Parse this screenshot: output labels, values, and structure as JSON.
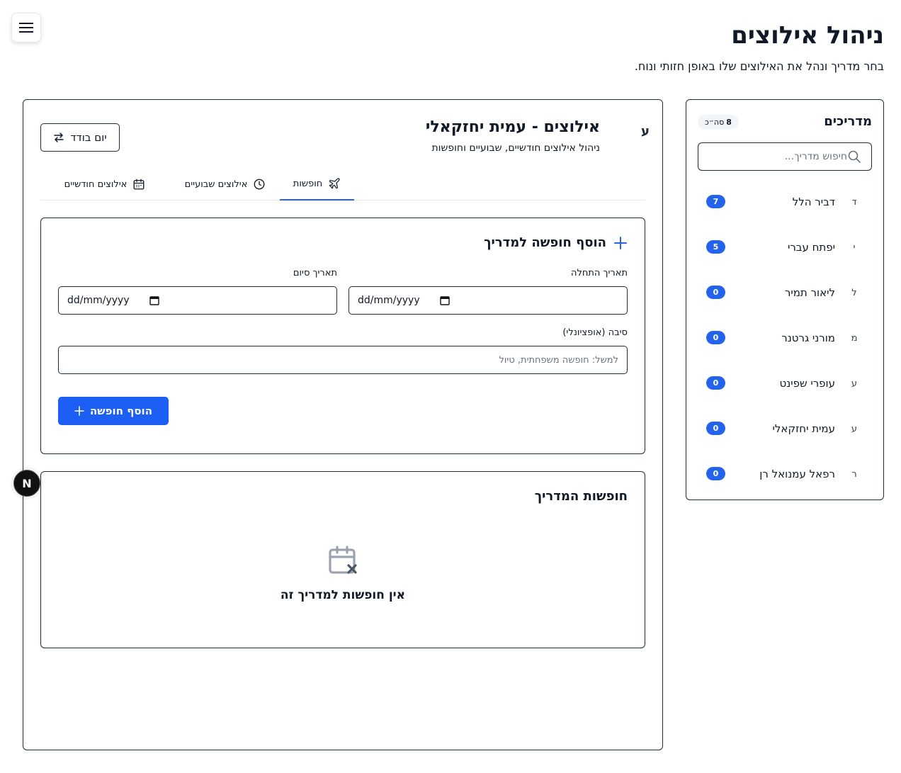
{
  "header": {
    "title": "ניהול אילוצים",
    "subtitle": "בחר מדריך ונהל את האילוצים שלו באופן חזותי ונוח."
  },
  "sidebar": {
    "title": "מדריכים",
    "count_number": "8",
    "count_suffix": "סה״כ",
    "search_placeholder": "חיפוש מדריך...",
    "guides": [
      {
        "initial": "ד",
        "name": "דביר הלל",
        "count": "7"
      },
      {
        "initial": "י",
        "name": "יפתח עברי",
        "count": "5"
      },
      {
        "initial": "ל",
        "name": "ליאור תמיר",
        "count": "0"
      },
      {
        "initial": "מ",
        "name": "מורני גרטנר",
        "count": "0"
      },
      {
        "initial": "ע",
        "name": "עופרי שפינט",
        "count": "0"
      },
      {
        "initial": "ע",
        "name": "עמית יחזקאלי",
        "count": "0"
      },
      {
        "initial": "ר",
        "name": "רפאל עמנואל רן",
        "count": "0"
      }
    ]
  },
  "main": {
    "avatar": "ע",
    "title": "אילוצים - עמית יחזקאלי",
    "subtitle": "ניהול אילוצים חודשיים, שבועיים וחופשות",
    "single_day_label": "יום בודד",
    "tabs": {
      "vacations": "חופשות",
      "weekly": "אילוצים שבועיים",
      "monthly": "אילוצים חודשיים"
    }
  },
  "add_form": {
    "title": "הוסף חופשה למדריך",
    "start_label": "תאריך התחלה",
    "end_label": "תאריך סיום",
    "start_value": "dd/mm/yyyy",
    "end_value": "dd/mm/yyyy",
    "reason_label": "סיבה (אופציונלי)",
    "reason_placeholder": "למשל: חופשה משפחתית, טיול",
    "submit_label": "הוסף חופשה"
  },
  "vacation_list": {
    "title": "חופשות המדריך",
    "empty_text": "אין חופשות למדריך זה"
  },
  "dev_badge": "N",
  "colors": {
    "accent": "#2563eb",
    "button": "#1d5ff5",
    "border": "#1e293b"
  }
}
